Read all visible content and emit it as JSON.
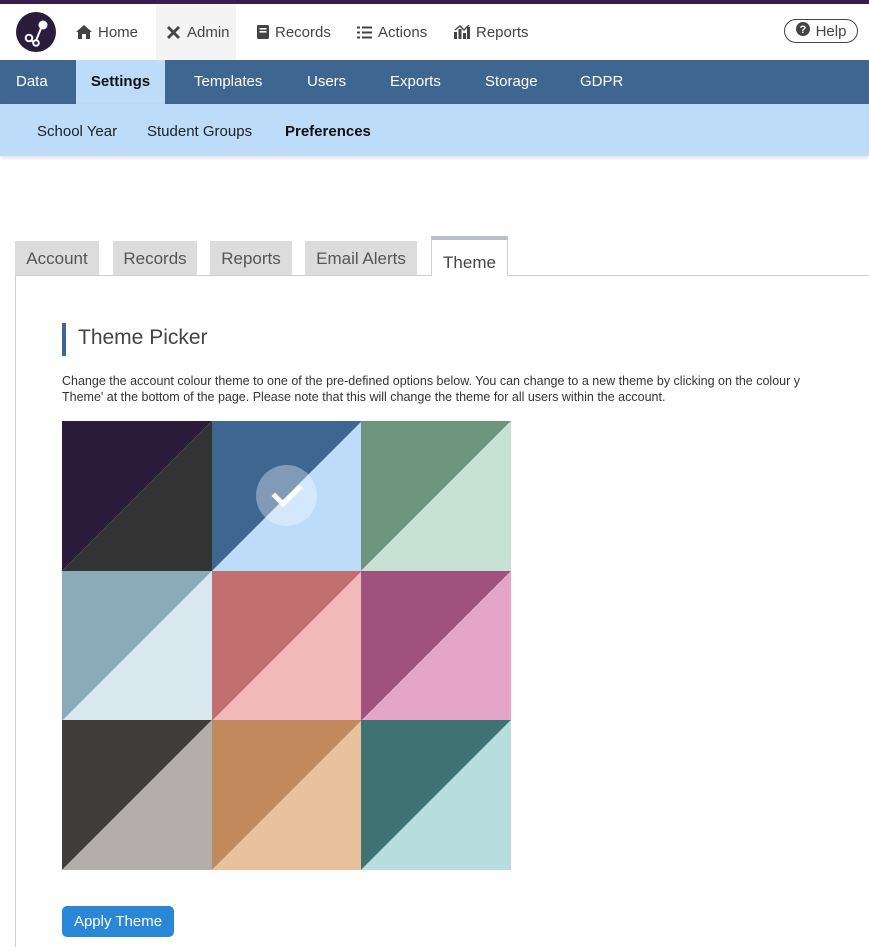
{
  "nav": {
    "items": [
      {
        "label": "Home",
        "icon": "home-icon"
      },
      {
        "label": "Admin",
        "icon": "tools-icon",
        "active": true
      },
      {
        "label": "Records",
        "icon": "book-icon"
      },
      {
        "label": "Actions",
        "icon": "list-icon"
      },
      {
        "label": "Reports",
        "icon": "chart-icon"
      }
    ],
    "help_label": "Help"
  },
  "admin_menu": {
    "items": [
      "Data",
      "Settings",
      "Templates",
      "Users",
      "Exports",
      "Storage",
      "GDPR"
    ],
    "active": "Settings"
  },
  "settings_menu": {
    "items": [
      "School Year",
      "Student Groups",
      "Preferences"
    ],
    "active": "Preferences"
  },
  "tabs": {
    "items": [
      "Account",
      "Records",
      "Reports",
      "Email Alerts",
      "Theme"
    ],
    "active": "Theme"
  },
  "theme_picker": {
    "title": "Theme Picker",
    "description_line1": "Change the account colour theme to one of the pre-defined options below. You can change to a new theme by clicking on the colour y",
    "description_line2": "Theme' at the bottom of the page. Please note that this will change the theme for all users within the account.",
    "themes": [
      {
        "primary": "#2b1c3b",
        "secondary": "#333333",
        "selected": false
      },
      {
        "primary": "#3e6690",
        "secondary": "#bcdcf9",
        "selected": true
      },
      {
        "primary": "#6d947d",
        "secondary": "#c6e2d3",
        "selected": false
      },
      {
        "primary": "#8aabb7",
        "secondary": "#d9e7ef",
        "selected": false
      },
      {
        "primary": "#c46f6f",
        "secondary": "#f2b9b9",
        "selected": false
      },
      {
        "primary": "#a0527f",
        "secondary": "#e4a5c9",
        "selected": false
      },
      {
        "primary": "#403e3b",
        "secondary": "#b3aeab",
        "selected": false
      },
      {
        "primary": "#c08a5c",
        "secondary": "#e9c09c",
        "selected": false
      },
      {
        "primary": "#3e7273",
        "secondary": "#b7dedf",
        "selected": false
      }
    ],
    "apply_label": "Apply Theme"
  }
}
